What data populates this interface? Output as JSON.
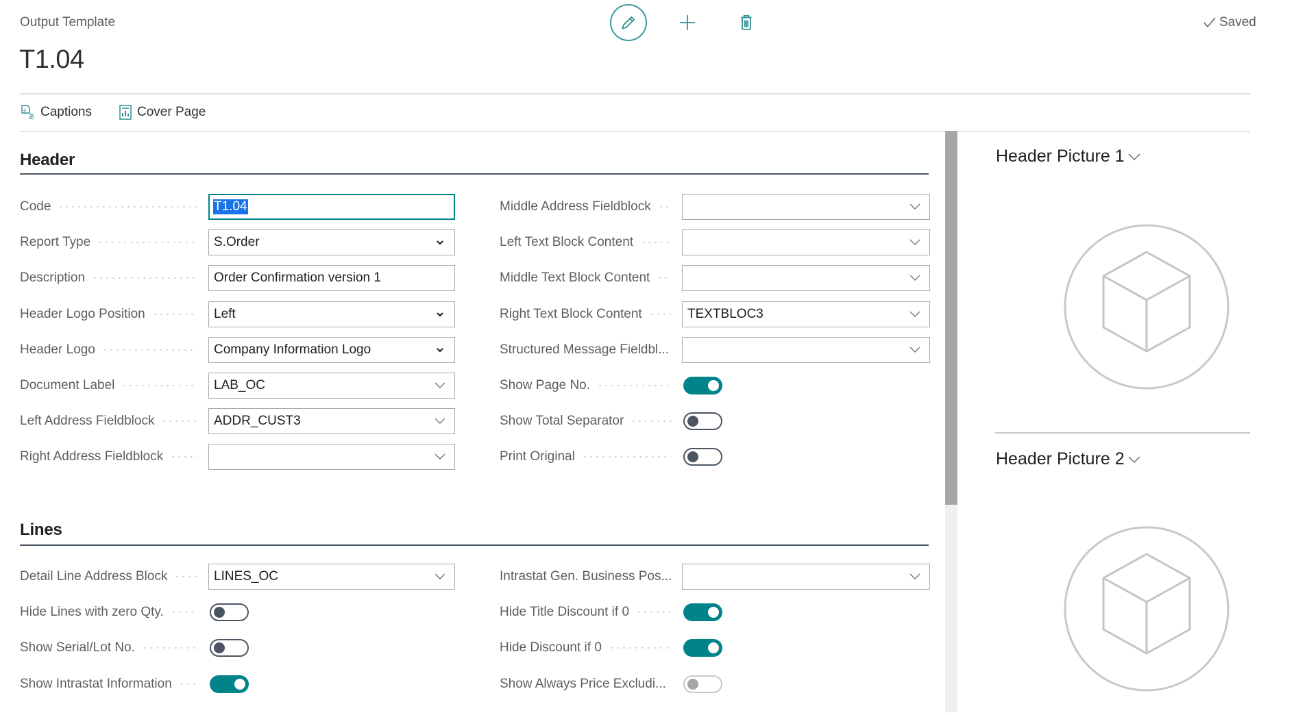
{
  "page": {
    "caption": "Output Template",
    "title": "T1.04",
    "status": "Saved"
  },
  "toolbar": {
    "edit_icon": "pencil-icon",
    "new_icon": "plus-icon",
    "delete_icon": "trash-icon"
  },
  "actions": [
    {
      "label": "Captions",
      "icon": "translate-icon"
    },
    {
      "label": "Cover Page",
      "icon": "report-icon"
    }
  ],
  "colors": {
    "accent": "#00838a",
    "selection": "#1a73e8",
    "section_line": "#4a5561"
  },
  "header": {
    "title": "Header",
    "left": [
      {
        "label": "Code",
        "type": "text",
        "value": "T1.04",
        "focused": true
      },
      {
        "label": "Report Type",
        "type": "select",
        "value": "S.Order"
      },
      {
        "label": "Description",
        "type": "text",
        "value": "Order Confirmation version 1"
      },
      {
        "label": "Header Logo Position",
        "type": "select",
        "value": "Left"
      },
      {
        "label": "Header Logo",
        "type": "select",
        "value": "Company Information Logo"
      },
      {
        "label": "Document Label",
        "type": "lookup",
        "value": "LAB_OC"
      },
      {
        "label": "Left Address Fieldblock",
        "type": "lookup",
        "value": "ADDR_CUST3"
      },
      {
        "label": "Right Address Fieldblock",
        "type": "lookup",
        "value": ""
      }
    ],
    "right": [
      {
        "label": "Middle Address Fieldblock",
        "type": "lookup",
        "value": ""
      },
      {
        "label": "Left Text Block Content",
        "type": "lookup",
        "value": ""
      },
      {
        "label": "Middle Text Block Content",
        "type": "lookup",
        "value": ""
      },
      {
        "label": "Right Text Block Content",
        "type": "lookup",
        "value": "TEXTBLOC3"
      },
      {
        "label": "Structured Message Fieldbl...",
        "type": "lookup",
        "value": ""
      },
      {
        "label": "Show Page No.",
        "type": "toggle",
        "value": true
      },
      {
        "label": "Show Total Separator",
        "type": "toggle",
        "value": false
      },
      {
        "label": "Print Original",
        "type": "toggle",
        "value": false
      }
    ]
  },
  "lines": {
    "title": "Lines",
    "left": [
      {
        "label": "Detail Line Address Block",
        "type": "lookup",
        "value": "LINES_OC"
      },
      {
        "label": "Hide Lines with zero Qty.",
        "type": "toggle",
        "value": false
      },
      {
        "label": "Show Serial/Lot No.",
        "type": "toggle",
        "value": false
      },
      {
        "label": "Show Intrastat Information",
        "type": "toggle",
        "value": true
      }
    ],
    "right": [
      {
        "label": "Intrastat Gen. Business Pos...",
        "type": "lookup",
        "value": ""
      },
      {
        "label": "Hide Title Discount if 0",
        "type": "toggle",
        "value": true
      },
      {
        "label": "Hide Discount if 0",
        "type": "toggle",
        "value": true
      },
      {
        "label": "Show Always Price Excludi...",
        "type": "toggle",
        "value": false,
        "disabled": true
      }
    ]
  },
  "factbox": [
    {
      "title": "Header Picture 1",
      "icon": "cube-placeholder-icon"
    },
    {
      "title": "Header Picture 2",
      "icon": "cube-placeholder-icon"
    }
  ]
}
